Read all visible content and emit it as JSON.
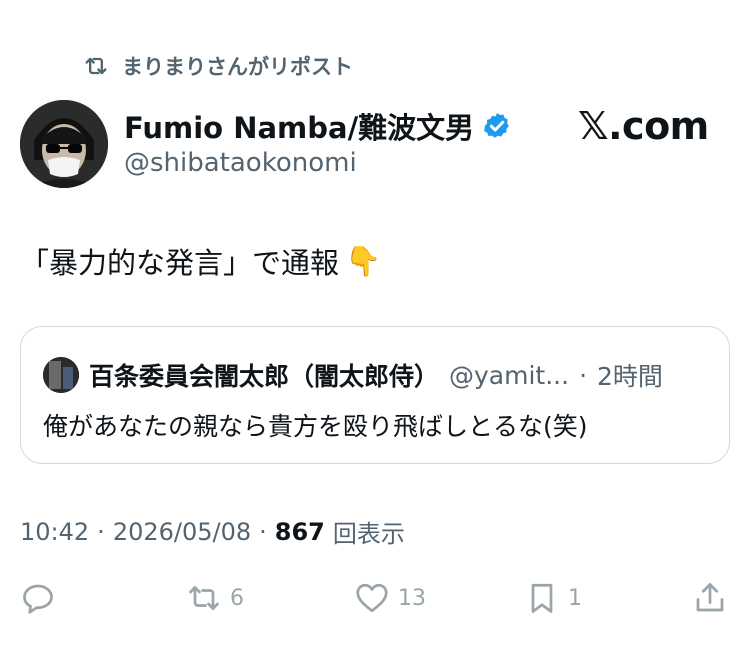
{
  "repost": {
    "text": "まりまりさんがリポスト",
    "icon": "repost-icon"
  },
  "author": {
    "display_name": "Fumio Namba/難波文男",
    "handle": "@shibataokonomi",
    "verified": true,
    "verified_color": "#1d9bf0"
  },
  "brand": {
    "text": "𝕏.com"
  },
  "post": {
    "text": "「暴力的な発言」で通報",
    "emoji": "👇"
  },
  "quote": {
    "name": "百条委員会闇太郎（闇太郎侍）",
    "handle": "@yamit...",
    "separator": "·",
    "time": "2時間",
    "text": "俺があなたの親なら貴方を殴り飛ばしとるな(笑)"
  },
  "meta": {
    "time": "10:42",
    "sep1": "·",
    "date": "2026/05/08",
    "sep2": "·",
    "views": "867",
    "views_label": "回表示"
  },
  "actions": {
    "reply": {
      "icon": "reply-icon",
      "count": ""
    },
    "repost": {
      "icon": "repost-icon",
      "count": "6"
    },
    "like": {
      "icon": "heart-icon",
      "count": "13"
    },
    "bookmark": {
      "icon": "bookmark-icon",
      "count": "1"
    },
    "share": {
      "icon": "share-icon",
      "count": ""
    }
  },
  "colors": {
    "text": "#0f1419",
    "secondary": "#536471",
    "action": "#9aa4ab",
    "border": "#cfd9de"
  }
}
